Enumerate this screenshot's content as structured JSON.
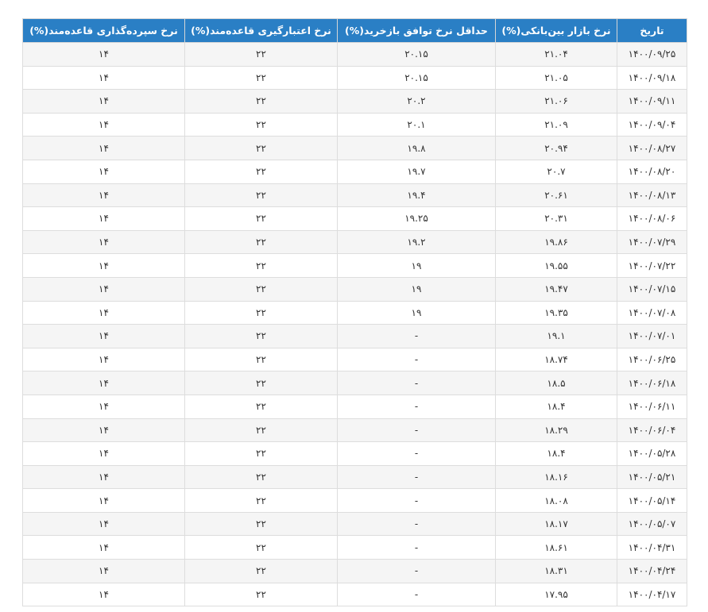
{
  "table": {
    "headers": [
      "تاریخ",
      "نرخ بازار بین‌بانکی(%)",
      "حداقل نرخ توافق بازخرید(%)",
      "نرخ اعتبارگیری قاعده‌مند(%)",
      "نرخ سپرده‌گذاری قاعده‌مند(%)"
    ],
    "rows": [
      [
        "۱۴۰۰/۰۹/۲۵",
        "۲۱.۰۴",
        "۲۰.۱۵",
        "۲۲",
        "۱۴"
      ],
      [
        "۱۴۰۰/۰۹/۱۸",
        "۲۱.۰۵",
        "۲۰.۱۵",
        "۲۲",
        "۱۴"
      ],
      [
        "۱۴۰۰/۰۹/۱۱",
        "۲۱.۰۶",
        "۲۰.۲",
        "۲۲",
        "۱۴"
      ],
      [
        "۱۴۰۰/۰۹/۰۴",
        "۲۱.۰۹",
        "۲۰.۱",
        "۲۲",
        "۱۴"
      ],
      [
        "۱۴۰۰/۰۸/۲۷",
        "۲۰.۹۴",
        "۱۹.۸",
        "۲۲",
        "۱۴"
      ],
      [
        "۱۴۰۰/۰۸/۲۰",
        "۲۰.۷",
        "۱۹.۷",
        "۲۲",
        "۱۴"
      ],
      [
        "۱۴۰۰/۰۸/۱۳",
        "۲۰.۶۱",
        "۱۹.۴",
        "۲۲",
        "۱۴"
      ],
      [
        "۱۴۰۰/۰۸/۰۶",
        "۲۰.۳۱",
        "۱۹.۲۵",
        "۲۲",
        "۱۴"
      ],
      [
        "۱۴۰۰/۰۷/۲۹",
        "۱۹.۸۶",
        "۱۹.۲",
        "۲۲",
        "۱۴"
      ],
      [
        "۱۴۰۰/۰۷/۲۲",
        "۱۹.۵۵",
        "۱۹",
        "۲۲",
        "۱۴"
      ],
      [
        "۱۴۰۰/۰۷/۱۵",
        "۱۹.۴۷",
        "۱۹",
        "۲۲",
        "۱۴"
      ],
      [
        "۱۴۰۰/۰۷/۰۸",
        "۱۹.۳۵",
        "۱۹",
        "۲۲",
        "۱۴"
      ],
      [
        "۱۴۰۰/۰۷/۰۱",
        "۱۹.۱",
        "-",
        "۲۲",
        "۱۴"
      ],
      [
        "۱۴۰۰/۰۶/۲۵",
        "۱۸.۷۴",
        "-",
        "۲۲",
        "۱۴"
      ],
      [
        "۱۴۰۰/۰۶/۱۸",
        "۱۸.۵",
        "-",
        "۲۲",
        "۱۴"
      ],
      [
        "۱۴۰۰/۰۶/۱۱",
        "۱۸.۴",
        "-",
        "۲۲",
        "۱۴"
      ],
      [
        "۱۴۰۰/۰۶/۰۴",
        "۱۸.۲۹",
        "-",
        "۲۲",
        "۱۴"
      ],
      [
        "۱۴۰۰/۰۵/۲۸",
        "۱۸.۴",
        "-",
        "۲۲",
        "۱۴"
      ],
      [
        "۱۴۰۰/۰۵/۲۱",
        "۱۸.۱۶",
        "-",
        "۲۲",
        "۱۴"
      ],
      [
        "۱۴۰۰/۰۵/۱۴",
        "۱۸.۰۸",
        "-",
        "۲۲",
        "۱۴"
      ],
      [
        "۱۴۰۰/۰۵/۰۷",
        "۱۸.۱۷",
        "-",
        "۲۲",
        "۱۴"
      ],
      [
        "۱۴۰۰/۰۴/۳۱",
        "۱۸.۶۱",
        "-",
        "۲۲",
        "۱۴"
      ],
      [
        "۱۴۰۰/۰۴/۲۴",
        "۱۸.۳۱",
        "-",
        "۲۲",
        "۱۴"
      ],
      [
        "۱۴۰۰/۰۴/۱۷",
        "۱۷.۹۵",
        "-",
        "۲۲",
        "۱۴"
      ]
    ]
  },
  "colors": {
    "header_bg": "#2a7fc5",
    "header_text": "#ffffff",
    "row_odd_bg": "#f5f5f5",
    "row_even_bg": "#ffffff",
    "border": "#dddddd"
  }
}
